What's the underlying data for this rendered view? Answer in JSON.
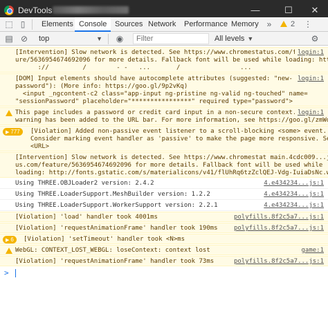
{
  "window": {
    "title": "DevTools - ",
    "minimize": "—",
    "maximize": "☐",
    "close": "✕"
  },
  "tabs": [
    {
      "label": "Elements"
    },
    {
      "label": "Console"
    },
    {
      "label": "Sources"
    },
    {
      "label": "Network"
    },
    {
      "label": "Performance"
    },
    {
      "label": "Memory"
    }
  ],
  "warning_count": "2",
  "filterbar": {
    "context": "top",
    "filter_placeholder": "Filter",
    "levels": "All levels"
  },
  "colors": {
    "accent": "#1a73e8",
    "warn_bg": "#fffbe5",
    "warn_icon": "#f4b400",
    "link": "#1a1aa6"
  },
  "messages": [
    {
      "lines": [
        "[Intervention] Slow network is detected. See https://www.chromestatus.com/feat",
        "ure/5636954674692096 for more details. Fallback font will be used while loading: htt",
        "      ://         /        - -   ...       /                ..."
      ],
      "source": "login:1"
    },
    {
      "lines": [
        "[DOM] Input elements should have autocomplete attributes (suggested: \"new-",
        "password\"): (More info: https://goo.gl/9p2vKq)",
        "  <input _ngcontent-c2 class=\"app-input ng-pristine ng-valid ng-touched\" name=",
        "\"sessionPassword\" placeholder=\"****************\" required type=\"password\">"
      ],
      "source": "login:1"
    },
    {
      "lines": [
        "This page includes a password or credit card input in a non-secure context. A",
        "warning has been added to the URL bar. For more information, see https://goo.gl/zmWq3m."
      ],
      "source": "login:1"
    },
    {
      "badge": "777",
      "lines": [
        "[Violation] Added non-passive event listener to a scroll-blocking <some> event.",
        "Consider marking event handler as 'passive' to make the page more responsive. See",
        "<URL>"
      ],
      "source": ""
    },
    {
      "lines": [
        "[Intervention] Slow network is detected. See https://www.chromestat main.4cdc009...js:1",
        "us.com/feature/5636954674692096 for more details. Fallback font will be used while",
        "loading: http://fonts.gstatic.com/s/materialicons/v41/flUhRq6tzZclQEJ-Vdg-IuiaDsNc.woff2"
      ],
      "source": ""
    },
    {
      "lines": [
        "Using THREE.OBJLoader2 version: 2.4.2"
      ],
      "source": "4.e434234...js:1"
    },
    {
      "lines": [
        "Using THREE.LoaderSupport.MeshBuilder version: 1.2.2"
      ],
      "source": "4.e434234...js:1"
    },
    {
      "lines": [
        "Using THREE.LoaderSupport.WorkerSupport version: 2.2.1"
      ],
      "source": "4.e434234...js:1"
    },
    {
      "lines": [
        "[Violation] 'load' handler took 4001ms"
      ],
      "source": "polyfills.8f2c5a7...js:1"
    },
    {
      "lines": [
        "[Violation] 'requestAnimationFrame' handler took 190ms"
      ],
      "source": "polyfills.8f2c5a7...js:1"
    },
    {
      "badge": "6",
      "lines": [
        "[Violation] 'setTimeout' handler took <N>ms"
      ],
      "source": ""
    },
    {
      "lines": [
        "WebGL: CONTEXT_LOST_WEBGL: loseContext: context lost"
      ],
      "source": "game:1"
    },
    {
      "lines": [
        "[Violation] 'requestAnimationFrame' handler took 73ms"
      ],
      "source": "polyfills.8f2c5a7...js:1"
    }
  ],
  "prompt_symbol": ">"
}
